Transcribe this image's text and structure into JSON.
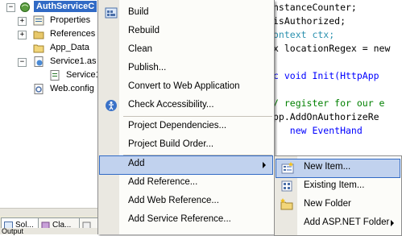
{
  "explorer": {
    "root_label": "AuthServiceC",
    "items": [
      {
        "label": "Properties"
      },
      {
        "label": "References"
      },
      {
        "label": "App_Data"
      },
      {
        "label": "Service1.as"
      },
      {
        "label": "Service1"
      },
      {
        "label": "Web.config"
      }
    ],
    "tabs": [
      {
        "label": "Sol..."
      },
      {
        "label": "Cla..."
      }
    ],
    "output_label": "Output"
  },
  "editor": {
    "lines": [
      "nstanceCounter;",
      "isAuthorized;",
      "ontext ctx;",
      "x locationRegex = new",
      "",
      "c void Init(HttpApp",
      "",
      "/ register for our e",
      "pp.AddOnAuthorizeRe",
      "   new EventHand"
    ]
  },
  "context_menu": {
    "items": [
      {
        "label": "Build",
        "icon": "build-icon"
      },
      {
        "label": "Rebuild"
      },
      {
        "label": "Clean"
      },
      {
        "label": "Publish..."
      },
      {
        "label": "Convert to Web Application"
      },
      {
        "label": "Check Accessibility...",
        "icon": "accessibility-icon"
      },
      {
        "label": "Project Dependencies..."
      },
      {
        "label": "Project Build Order..."
      },
      {
        "label": "Add",
        "has_submenu": true
      },
      {
        "label": "Add Reference..."
      },
      {
        "label": "Add Web Reference..."
      },
      {
        "label": "Add Service Reference..."
      }
    ]
  },
  "add_submenu": {
    "items": [
      {
        "label": "New Item...",
        "icon": "new-item-icon"
      },
      {
        "label": "Existing Item...",
        "icon": "existing-item-icon"
      },
      {
        "label": "New Folder",
        "icon": "new-folder-icon"
      },
      {
        "label": "Add ASP.NET Folder",
        "has_submenu": true
      }
    ]
  },
  "colors": {
    "selection": "#316ac5",
    "menu_highlight": "#c1d2ee",
    "keyword": "#0000ff",
    "comment": "#008000"
  }
}
